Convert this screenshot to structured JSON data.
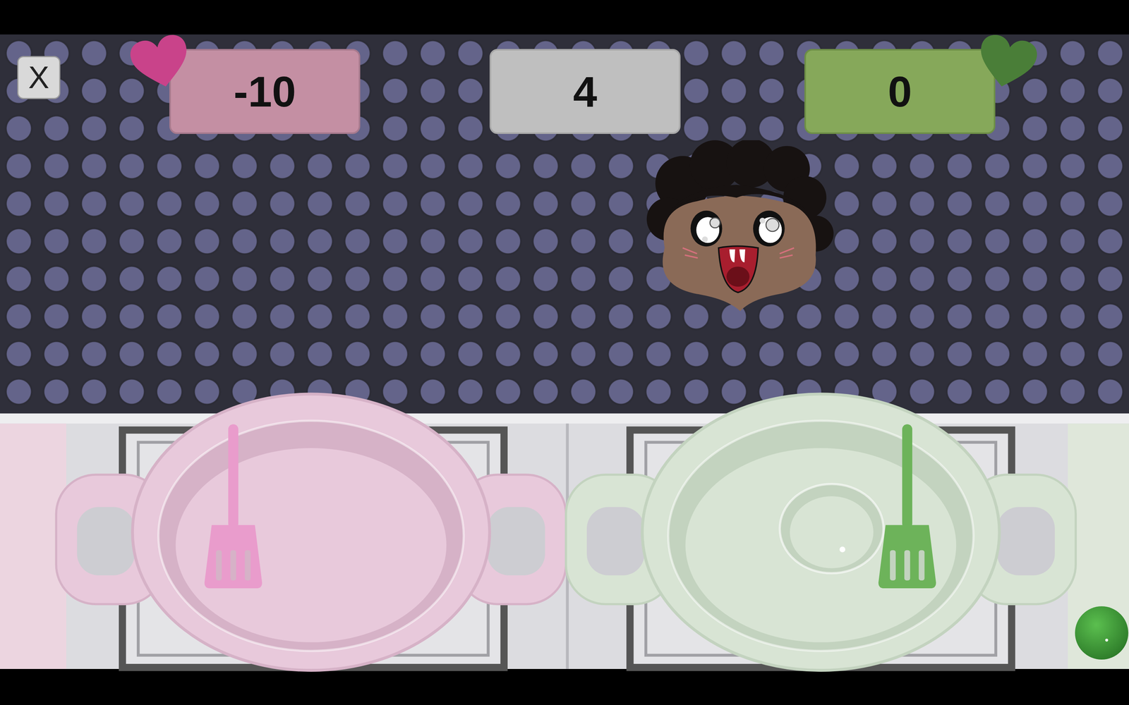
{
  "close_button": "X",
  "round": "4",
  "players": [
    {
      "name": "pink",
      "score": "-10",
      "box_color": "#c48fa3",
      "border_color": "#a77a8d",
      "heart_color": "#c9438a",
      "pan_color": "#e8c9db",
      "pan_inner": "#d6b2c7",
      "spatula_color": "#e99ccc",
      "has_food": false
    },
    {
      "name": "green",
      "score": "0",
      "box_color": "#86a85a",
      "border_color": "#6d8e46",
      "heart_color": "#4a7e38",
      "pan_color": "#d8e4d4",
      "pan_inner": "#c3d3bf",
      "spatula_color": "#6db35a",
      "has_food": true
    }
  ]
}
